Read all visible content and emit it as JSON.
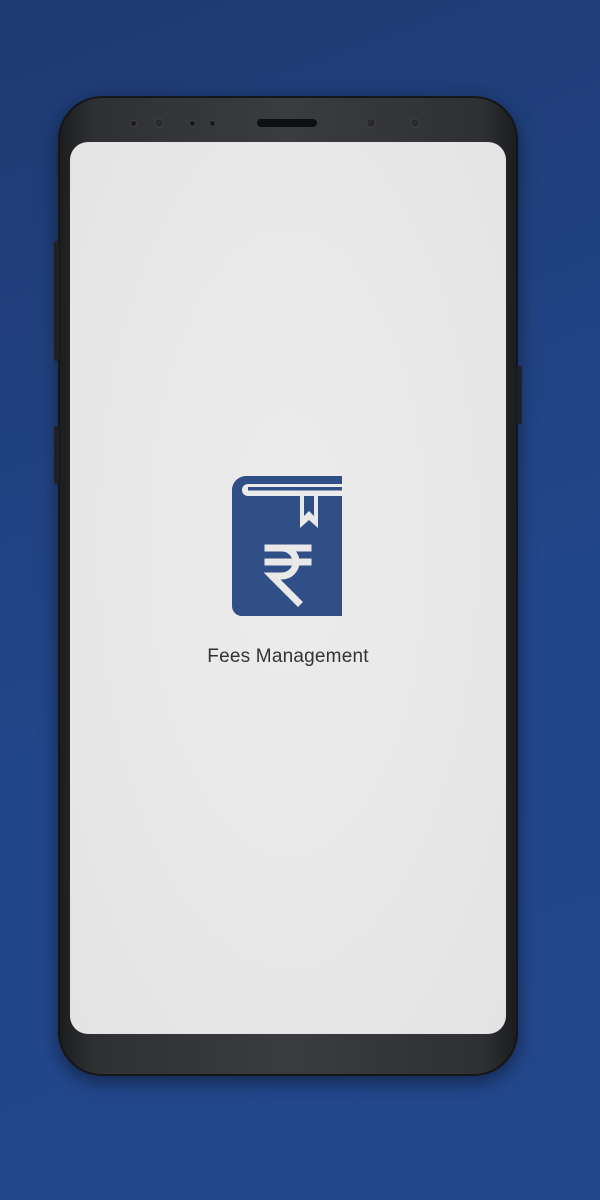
{
  "app": {
    "name": "Fees Management",
    "logo_icon": "book-rupee-icon",
    "brand_color": "#2f4f86"
  },
  "colors": {
    "background": "#22468a",
    "screen": "#e9e9e9",
    "text": "#333333"
  }
}
